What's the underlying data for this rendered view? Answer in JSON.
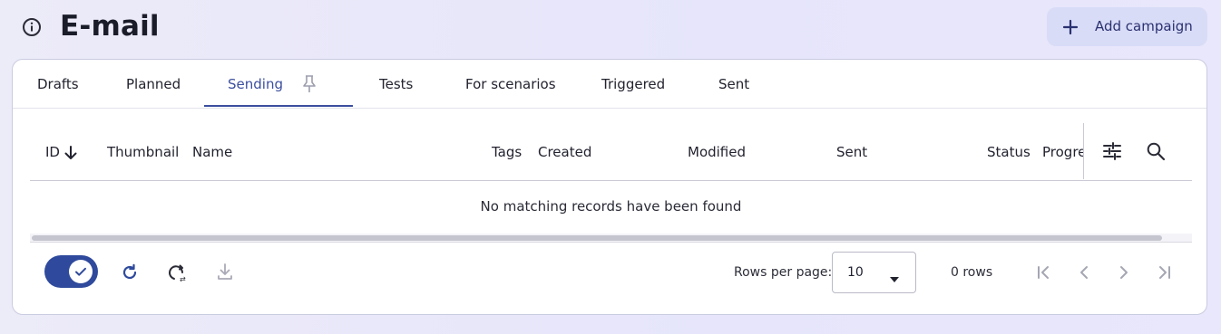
{
  "header": {
    "title": "E-mail",
    "add_button_label": "Add campaign"
  },
  "tabs": [
    {
      "label": "Drafts",
      "active": false
    },
    {
      "label": "Planned",
      "active": false
    },
    {
      "label": "Sending",
      "active": true,
      "pinned": true
    },
    {
      "label": "Tests",
      "active": false
    },
    {
      "label": "For scenarios",
      "active": false
    },
    {
      "label": "Triggered",
      "active": false
    },
    {
      "label": "Sent",
      "active": false
    }
  ],
  "table": {
    "columns": {
      "id": "ID",
      "thumbnail": "Thumbnail",
      "name": "Name",
      "tags": "Tags",
      "created": "Created",
      "modified": "Modified",
      "sent": "Sent",
      "status": "Status",
      "progress": "Progress"
    },
    "sort": {
      "column": "ID",
      "direction": "descending"
    },
    "empty_message": "No matching records have been found"
  },
  "footer": {
    "auto_refresh_enabled": true,
    "rows_per_page_label": "Rows per page:",
    "rows_per_page_value": "10",
    "rows_count": "0 rows"
  },
  "icons": {
    "info": "info-circle-icon",
    "add": "plus-icon",
    "pin": "pin-icon",
    "sort": "arrow-down-icon",
    "column_settings": "sliders-icon",
    "search": "search-icon",
    "refresh": "refresh-icon",
    "auto_refresh": "auto-refresh-icon",
    "download": "download-icon",
    "pagination": [
      "first-page-icon",
      "prev-page-icon",
      "next-page-icon",
      "last-page-icon"
    ]
  },
  "colors": {
    "accent": "#3c4e9e",
    "toggle_on": "#2f4a9c",
    "add_button_bg": "#d9dcf7"
  }
}
